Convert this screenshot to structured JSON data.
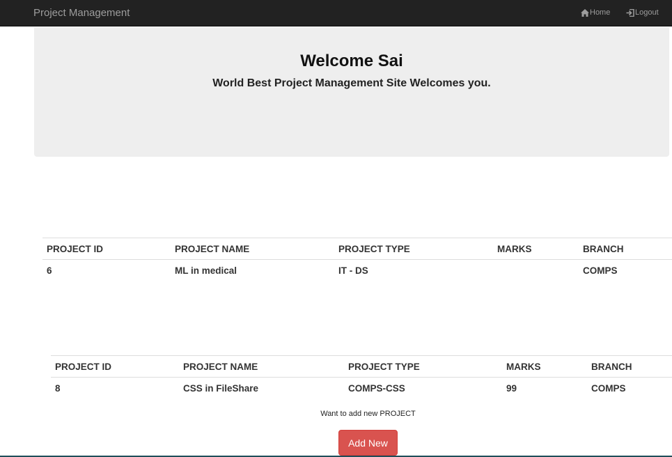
{
  "navbar": {
    "brand": "Project Management",
    "home_label": "Home",
    "logout_label": "Logout"
  },
  "jumbotron": {
    "title": "Welcome Sai",
    "tagline": "World Best Project Management Site Welcomes you."
  },
  "tables": [
    {
      "headers": [
        "PROJECT ID",
        "PROJECT NAME",
        "PROJECT TYPE",
        "MARKS",
        "BRANCH"
      ],
      "rows": [
        [
          "6",
          "ML in medical",
          "IT - DS",
          "",
          "COMPS"
        ]
      ]
    },
    {
      "headers": [
        "PROJECT ID",
        "PROJECT NAME",
        "PROJECT TYPE",
        "MARKS",
        "BRANCH"
      ],
      "rows": [
        [
          "8",
          "CSS in FileShare",
          "COMPS-CSS",
          "99",
          "COMPS"
        ]
      ]
    }
  ],
  "add_section": {
    "prompt": "Want to add new PROJECT",
    "button_label": "Add New"
  },
  "colors": {
    "navbar_bg": "#222222",
    "jumbotron_bg": "#eeeeee",
    "danger_button": "#d9534f"
  },
  "icons": {
    "home": "home-icon",
    "logout": "log-in-icon"
  }
}
